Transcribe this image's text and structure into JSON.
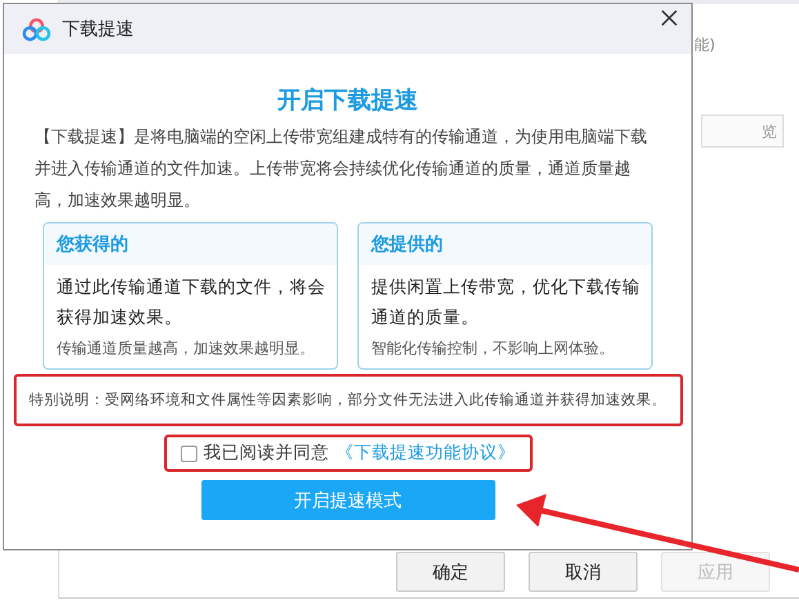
{
  "background_window": {
    "partial_text": "能)",
    "partial_button": "览",
    "buttons": [
      {
        "label": "确定",
        "disabled": false
      },
      {
        "label": "取消",
        "disabled": false
      },
      {
        "label": "应用",
        "disabled": true
      }
    ]
  },
  "dialog": {
    "title": "下载提速",
    "heading": "开启下载提速",
    "description": "【下载提速】是将电脑端的空闲上传带宽组建成特有的传输通道，为使用电脑端下载并进入传输通道的文件加速。上传带宽将会持续优化传输通道的质量，通道质量越高，加速效果越明显。",
    "cards": [
      {
        "title": "您获得的",
        "body": "通过此传输通道下载的文件，将会获得加速效果。",
        "footnote": "传输通道质量越高，加速效果越明显。"
      },
      {
        "title": "您提供的",
        "body": "提供闲置上传带宽，优化下载传输通道的质量。",
        "footnote": "智能化传输控制，不影响上网体验。"
      }
    ],
    "note": "特别说明：受网络环境和文件属性等因素影响，部分文件无法进入此传输通道并获得加速效果。",
    "agreement": {
      "checked": false,
      "label": "我已阅读并同意",
      "link": "《下载提速功能协议》"
    },
    "button": "开启提速模式"
  }
}
